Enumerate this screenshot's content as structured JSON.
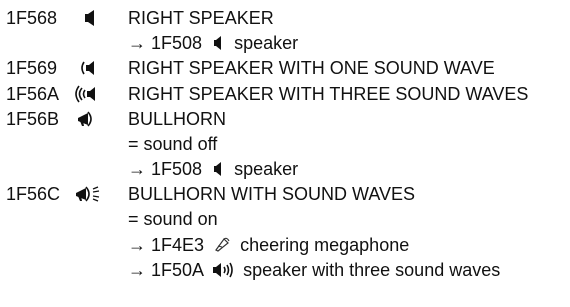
{
  "entries": [
    {
      "code": "1F568",
      "icon": "right-speaker-icon",
      "name": "RIGHT SPEAKER",
      "xrefs": [
        {
          "arrow": "→",
          "code": "1F508",
          "icon": "speaker-icon",
          "text": "speaker"
        }
      ]
    },
    {
      "code": "1F569",
      "icon": "right-speaker-one-wave-icon",
      "name": "RIGHT SPEAKER WITH ONE SOUND WAVE"
    },
    {
      "code": "1F56A",
      "icon": "right-speaker-three-waves-icon",
      "name": "RIGHT SPEAKER WITH THREE SOUND WAVES"
    },
    {
      "code": "1F56B",
      "icon": "bullhorn-icon",
      "name": "BULLHORN",
      "alias": {
        "sign": "=",
        "text": "sound off"
      },
      "xrefs": [
        {
          "arrow": "→",
          "code": "1F508",
          "icon": "speaker-icon",
          "text": "speaker"
        }
      ]
    },
    {
      "code": "1F56C",
      "icon": "bullhorn-sound-waves-icon",
      "name": "BULLHORN WITH SOUND WAVES",
      "alias": {
        "sign": "=",
        "text": "sound on"
      },
      "xrefs": [
        {
          "arrow": "→",
          "code": "1F4E3",
          "icon": "cheering-megaphone-icon",
          "text": "cheering megaphone"
        },
        {
          "arrow": "→",
          "code": "1F50A",
          "icon": "speaker-three-waves-icon",
          "text": "speaker with three sound waves"
        }
      ]
    }
  ]
}
